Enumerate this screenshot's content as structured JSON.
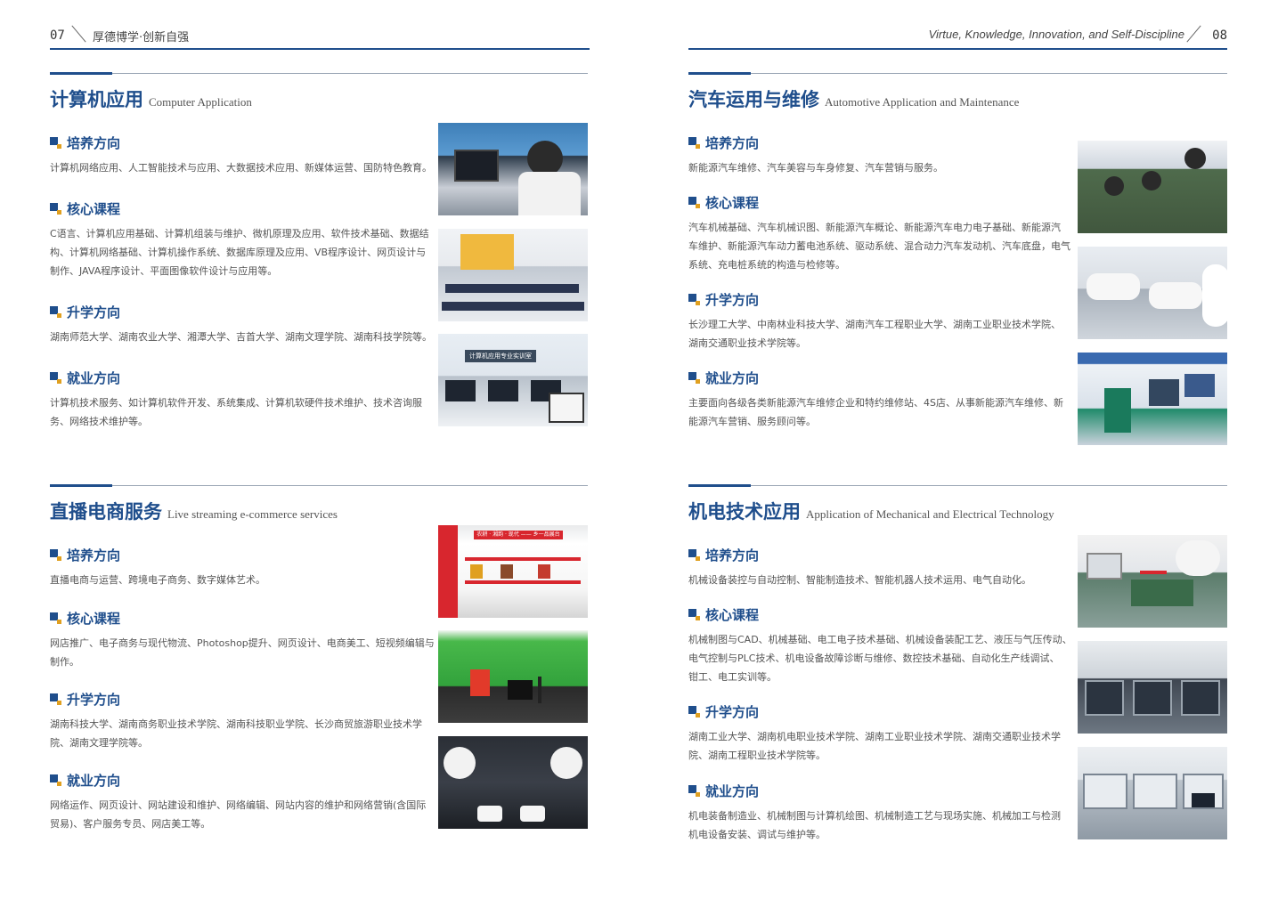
{
  "header": {
    "left_page_num": "07",
    "left_text": "厚德博学·创新自强",
    "right_text": "Virtue, Knowledge, Innovation, and Self-Discipline",
    "right_page_num": "08"
  },
  "sections": {
    "computer": {
      "title_zh": "计算机应用",
      "title_en": "Computer Application",
      "training_label": "培养方向",
      "training_text": "计算机网络应用、人工智能技术与应用、大数据技术应用、新媒体运营、国防特色教育。",
      "core_label": "核心课程",
      "core_line1": "C语言、计算机应用基础、计算机组装与维护、微机原理及应用、软件技术基础、数据结",
      "core_line2": "构、计算机网络基础、计算机操作系统、数据库原理及应用、VB程序设计、网页设计与",
      "core_line3": "制作、JAVA程序设计、平面图像软件设计与应用等。",
      "further_label": "升学方向",
      "further_text": "湖南师范大学、湖南农业大学、湘潭大学、吉首大学、湖南文理学院、湖南科技学院等。",
      "job_label": "就业方向",
      "job_line1": "计算机技术服务、如计算机软件开发、系统集成、计算机软硬件技术维护、技术咨询服",
      "job_line2": "务、网络技术维护等。",
      "photo3_sign": "计算机应用专业实训室"
    },
    "auto": {
      "title_zh": "汽车运用与维修",
      "title_en": "Automotive Application and Maintenance",
      "training_label": "培养方向",
      "training_text": "新能源汽车维修、汽车美容与车身修复、汽车营销与服务。",
      "core_label": "核心课程",
      "core_line1": "汽车机械基础、汽车机械识图、新能源汽车概论、新能源汽车电力电子基础、新能源汽",
      "core_line2": "车维护、新能源汽车动力蓄电池系统、驱动系统、混合动力汽车发动机、汽车底盘，电气",
      "core_line3": "系统、充电桩系统的构造与检修等。",
      "further_label": "升学方向",
      "further_line1": "长沙理工大学、中南林业科技大学、湖南汽车工程职业大学、湖南工业职业技术学院、",
      "further_line2": "湖南交通职业技术学院等。",
      "job_label": "就业方向",
      "job_line1": "主要面向各级各类新能源汽车维修企业和特约维修站、4S店、从事新能源汽车维修、新",
      "job_line2": "能源汽车营销、服务顾问等。"
    },
    "ecommerce": {
      "title_zh": "直播电商服务",
      "title_en": "Live streaming e-commerce services",
      "training_label": "培养方向",
      "training_text": "直播电商与运营、跨境电子商务、数字媒体艺术。",
      "core_label": "核心课程",
      "core_line1": "网店推广、电子商务与现代物流、Photoshop提升、网页设计、电商美工、短视频编辑与",
      "core_line2": "制作。",
      "further_label": "升学方向",
      "further_line1": "湖南科技大学、湖南商务职业技术学院、湖南科技职业学院、长沙商贸旅游职业技术学",
      "further_line2": "院、湖南文理学院等。",
      "job_label": "就业方向",
      "job_line1": "网络运作、网页设计、网站建设和维护、网络编辑、网站内容的维护和网络营销(含国际",
      "job_line2": "贸易)、客户服务专员、网店美工等。",
      "photo1_sign": "农耕 · 湘韵 · 现代 —— 乡一品展台"
    },
    "mechatronics": {
      "title_zh": "机电技术应用",
      "title_en": "Application of Mechanical and Electrical Technology",
      "training_label": "培养方向",
      "training_text": "机械设备装控与自动控制、智能制造技术、智能机器人技术运用、电气自动化。",
      "core_label": "核心课程",
      "core_line1": "机械制图与CAD、机械基础、电工电子技术基础、机械设备装配工艺、液压与气压传动、",
      "core_line2": "电气控制与PLC技术、机电设备故障诊断与维修、数控技术基础、自动化生产线调试、",
      "core_line3": "钳工、电工实训等。",
      "further_label": "升学方向",
      "further_line1": "湖南工业大学、湖南机电职业技术学院、湖南工业职业技术学院、湖南交通职业技术学",
      "further_line2": "院、湖南工程职业技术学院等。",
      "job_label": "就业方向",
      "job_line1": "机电装备制造业、机械制图与计算机绘图、机械制造工艺与现场实施、机械加工与检测",
      "job_line2": "机电设备安装、调试与维护等。"
    }
  },
  "colors": {
    "accent": "#1f4e8c",
    "accent2": "#e0a020",
    "text": "#555555"
  },
  "icons": {
    "bullet": "square-bullet-icon"
  }
}
